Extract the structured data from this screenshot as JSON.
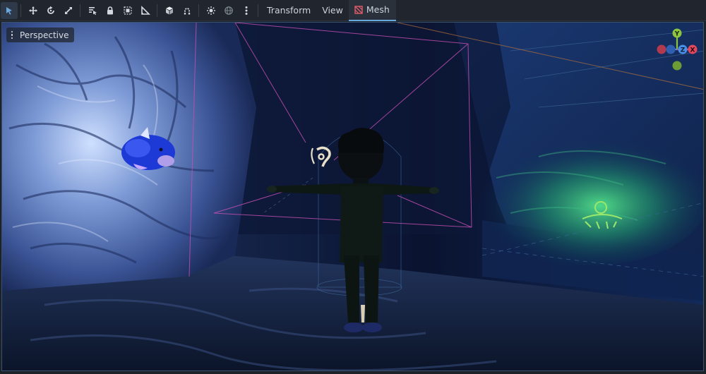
{
  "toolbar": {
    "tools": [
      {
        "name": "select-tool-icon",
        "active": true
      },
      {
        "name": "move-tool-icon"
      },
      {
        "name": "rotate-tool-icon"
      },
      {
        "name": "scale-tool-icon"
      },
      {
        "name": "list-select-icon"
      },
      {
        "name": "lock-icon"
      },
      {
        "name": "group-icon"
      },
      {
        "name": "ruler-icon"
      },
      {
        "name": "local-space-icon"
      },
      {
        "name": "snap-icon"
      },
      {
        "name": "sun-icon"
      },
      {
        "name": "environment-icon"
      },
      {
        "name": "more-icon"
      }
    ],
    "menus": {
      "transform": "Transform",
      "view": "View",
      "mesh": "Mesh"
    }
  },
  "viewport": {
    "perspective_label": "Perspective",
    "gizmo": {
      "y": "Y",
      "z": "Z",
      "x": "X"
    }
  },
  "colors": {
    "accent": "#6aa8e0",
    "gizmo_x": "#e0485e",
    "gizmo_y": "#8cc63f",
    "gizmo_z": "#4a8fe7",
    "mesh_icon": "#e05c6a"
  }
}
